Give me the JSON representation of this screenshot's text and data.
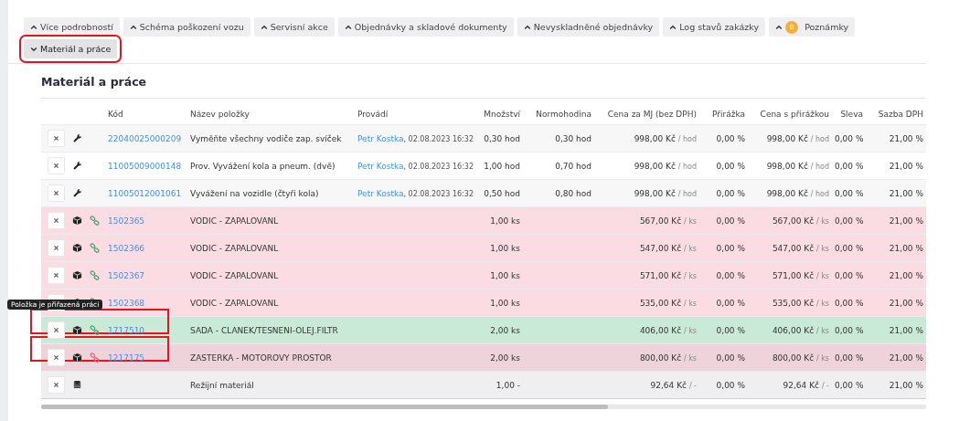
{
  "tabs": [
    {
      "label": "Více podrobností",
      "expanded": false,
      "annotated": false
    },
    {
      "label": "Schéma poškození vozu",
      "expanded": false,
      "annotated": false
    },
    {
      "label": "Servisní akce",
      "expanded": false,
      "annotated": false
    },
    {
      "label": "Objednávky a skladové dokumenty",
      "expanded": false,
      "annotated": false
    },
    {
      "label": "Nevyskladněné objednávky",
      "expanded": false,
      "annotated": false
    },
    {
      "label": "Log stavů zakázky",
      "expanded": false,
      "annotated": false
    },
    {
      "label": "Poznámky",
      "expanded": false,
      "annotated": false,
      "badge": "0"
    },
    {
      "label": "Materiál a práce",
      "expanded": true,
      "annotated": true
    }
  ],
  "section_title": "Materiál a práce",
  "columns": [
    "Kód",
    "Název položky",
    "Provádí",
    "Množství",
    "Normohodina",
    "Cena za MJ (bez DPH)",
    "Přirážka",
    "Cena s přirážkou",
    "Sleva",
    "Sazba DPH"
  ],
  "rows": [
    {
      "kind": "labor",
      "color": "#f7f7f8",
      "annotated": false,
      "code": "22040025000209",
      "name": "Vyměňte všechny vodiče zap. svíček",
      "person": "Petr Kostka",
      "time": ", 02.08.2023 16:32",
      "qty": "0,30 hod",
      "norm": "0,30 hod",
      "price": "998,00 Kč",
      "price_unit": "/ hod",
      "markup": "0,00 %",
      "price2": "998,00 Kč",
      "price2_unit": "/ hod",
      "discount": "0,00 %",
      "vat": "21,00 %"
    },
    {
      "kind": "labor",
      "color": "#ffffff",
      "annotated": false,
      "code": "11005009000148",
      "name": "Prov. Vyvážení kola a pneum. (dvě)",
      "person": "Petr Kostka",
      "time": ", 02.08.2023 16:32",
      "qty": "1,00 hod",
      "norm": "0,70 hod",
      "price": "998,00 Kč",
      "price_unit": "/ hod",
      "markup": "0,00 %",
      "price2": "998,00 Kč",
      "price2_unit": "/ hod",
      "discount": "0,00 %",
      "vat": "21,00 %"
    },
    {
      "kind": "labor",
      "color": "#f7f7f8",
      "annotated": false,
      "code": "11005012001061",
      "name": "Vyvážení na vozidle (čtyři kola)",
      "person": "Petr Kostka",
      "time": ", 02.08.2023 16:32",
      "qty": "0,50 hod",
      "norm": "0,80 hod",
      "price": "998,00 Kč",
      "price_unit": "/ hod",
      "markup": "0,00 %",
      "price2": "998,00 Kč",
      "price2_unit": "/ hod",
      "discount": "0,00 %",
      "vat": "21,00 %"
    },
    {
      "kind": "part",
      "linked": true,
      "color": "#fbdce3",
      "annotated": false,
      "code": "1502365",
      "name": "VODIC - ZAPALOVANL",
      "qty": "1,00 ks",
      "price": "567,00 Kč",
      "price_unit": "/ ks",
      "markup": "0,00 %",
      "price2": "567,00 Kč",
      "price2_unit": "/ ks",
      "discount": "0,00 %",
      "vat": "21,00 %"
    },
    {
      "kind": "part",
      "linked": true,
      "color": "#fbdce3",
      "annotated": false,
      "code": "1502366",
      "name": "VODIC - ZAPALOVANL",
      "qty": "1,00 ks",
      "price": "547,00 Kč",
      "price_unit": "/ ks",
      "markup": "0,00 %",
      "price2": "547,00 Kč",
      "price2_unit": "/ ks",
      "discount": "0,00 %",
      "vat": "21,00 %"
    },
    {
      "kind": "part",
      "linked": true,
      "color": "#fbdce3",
      "annotated": false,
      "code": "1502367",
      "name": "VODIC - ZAPALOVANL",
      "qty": "1,00 ks",
      "price": "571,00 Kč",
      "price_unit": "/ ks",
      "markup": "0,00 %",
      "price2": "571,00 Kč",
      "price2_unit": "/ ks",
      "discount": "0,00 %",
      "vat": "21,00 %"
    },
    {
      "kind": "part",
      "linked": true,
      "color": "#fbdce3",
      "annotated": false,
      "code": "1502368",
      "name": "VODIC - ZAPALOVANL",
      "qty": "1,00 ks",
      "price": "535,00 Kč",
      "price_unit": "/ ks",
      "markup": "0,00 %",
      "price2": "535,00 Kč",
      "price2_unit": "/ ks",
      "discount": "0,00 %",
      "vat": "21,00 %"
    },
    {
      "kind": "part",
      "linked": true,
      "color": "#c8ead6",
      "annotated": true,
      "tooltip": "Položka je přiřazená práci",
      "code": "1717510",
      "name": "SADA - CLANEK/TESNENI-OLEJ.FILTR",
      "qty": "2,00 ks",
      "price": "406,00 Kč",
      "price_unit": "/ ks",
      "markup": "0,00 %",
      "price2": "406,00 Kč",
      "price2_unit": "/ ks",
      "discount": "0,00 %",
      "vat": "21,00 %"
    },
    {
      "kind": "part",
      "linked": false,
      "color": "#efd3da",
      "annotated": true,
      "code": "1217175",
      "name": "ZASTERKA - MOTOROVY PROSTOR",
      "qty": "2,00 ks",
      "price": "800,00 Kč",
      "price_unit": "/ ks",
      "markup": "0,00 %",
      "price2": "800,00 Kč",
      "price2_unit": "/ ks",
      "discount": "0,00 %",
      "vat": "21,00 %"
    },
    {
      "kind": "overhead",
      "color": "#efefef",
      "annotated": false,
      "name": "Režijní materiál",
      "qty": "1,00 -",
      "price": "92,64 Kč",
      "price_unit": "/ -",
      "markup": "0,00 %",
      "price2": "92,64 Kč",
      "price2_unit": "/ -",
      "discount": "0,00 %",
      "vat": "21,00 %"
    }
  ]
}
